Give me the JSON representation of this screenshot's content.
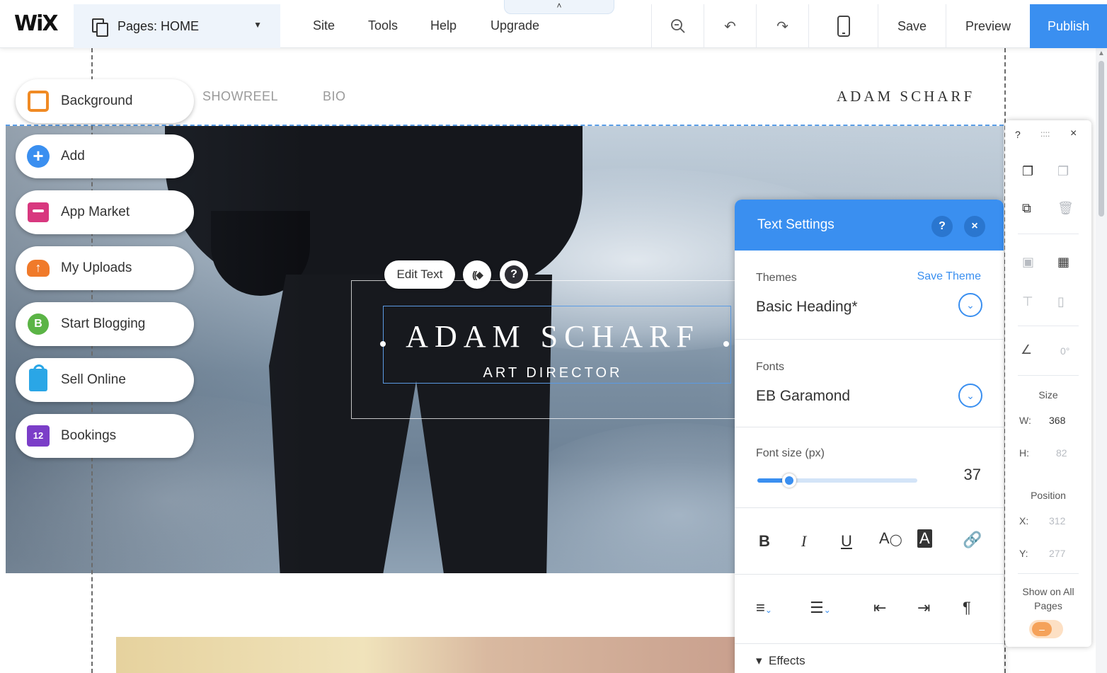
{
  "app": {
    "logo": "WiX"
  },
  "topbar": {
    "pages_dropdown": "Pages: HOME",
    "menu": [
      "Site",
      "Tools",
      "Help",
      "Upgrade"
    ],
    "collapse_arrow": "˄",
    "tools": {
      "zoom_icon": "zoom-out-icon",
      "undo_icon": "undo-icon",
      "redo_icon": "redo-icon",
      "mobile_icon": "mobile-view-icon"
    },
    "save": "Save",
    "preview": "Preview",
    "publish": "Publish"
  },
  "site": {
    "nav": [
      "SHOWREEL",
      "BIO"
    ],
    "brand": "ADAM SCHARF",
    "hero_title": "ADAM SCHARF",
    "hero_subtitle": "ART DIRECTOR"
  },
  "edit_toolbar": {
    "edit_text": "Edit Text",
    "help": "?"
  },
  "left_panel": {
    "items": [
      {
        "label": "Background",
        "icon": "background-icon"
      },
      {
        "label": "Add",
        "icon": "add-icon"
      },
      {
        "label": "App Market",
        "icon": "app-market-icon"
      },
      {
        "label": "My Uploads",
        "icon": "uploads-icon"
      },
      {
        "label": "Start Blogging",
        "icon": "blog-icon"
      },
      {
        "label": "Sell Online",
        "icon": "shopping-bag-icon"
      },
      {
        "label": "Bookings",
        "icon": "calendar-icon"
      }
    ],
    "blog_letter": "B",
    "bookings_badge": "12"
  },
  "text_settings": {
    "title": "Text Settings",
    "help": "?",
    "close": "×",
    "themes_label": "Themes",
    "save_theme": "Save Theme",
    "theme_value": "Basic Heading*",
    "fonts_label": "Fonts",
    "font_value": "EB Garamond",
    "font_size_label": "Font size (px)",
    "font_size_value": "37",
    "font_size_slider_fraction": 0.2,
    "format": {
      "bold": "B",
      "italic": "I",
      "underline": "U",
      "text_color": "A",
      "highlight": "A"
    },
    "effects": "Effects"
  },
  "right_toolbar": {
    "help": "?",
    "drag": "::::",
    "close": "×",
    "rotation": "0°",
    "size_label": "Size",
    "w_label": "W:",
    "w_value": "368",
    "h_label": "H:",
    "h_value": "82",
    "position_label": "Position",
    "x_label": "X:",
    "x_value": "312",
    "y_label": "Y:",
    "y_value": "277",
    "show_on_all_pages": "Show on All Pages",
    "toggle_symbol": "–"
  },
  "colors": {
    "accent": "#3a8ff0",
    "publish_bg": "#3a8ff0",
    "background_icon": "#f08a24",
    "app_market_icon": "#d8387f",
    "uploads_icon": "#f07a2a",
    "blog_icon": "#5bb446",
    "sell_icon": "#2aa6e6",
    "bookings_icon": "#7b3ec8"
  }
}
